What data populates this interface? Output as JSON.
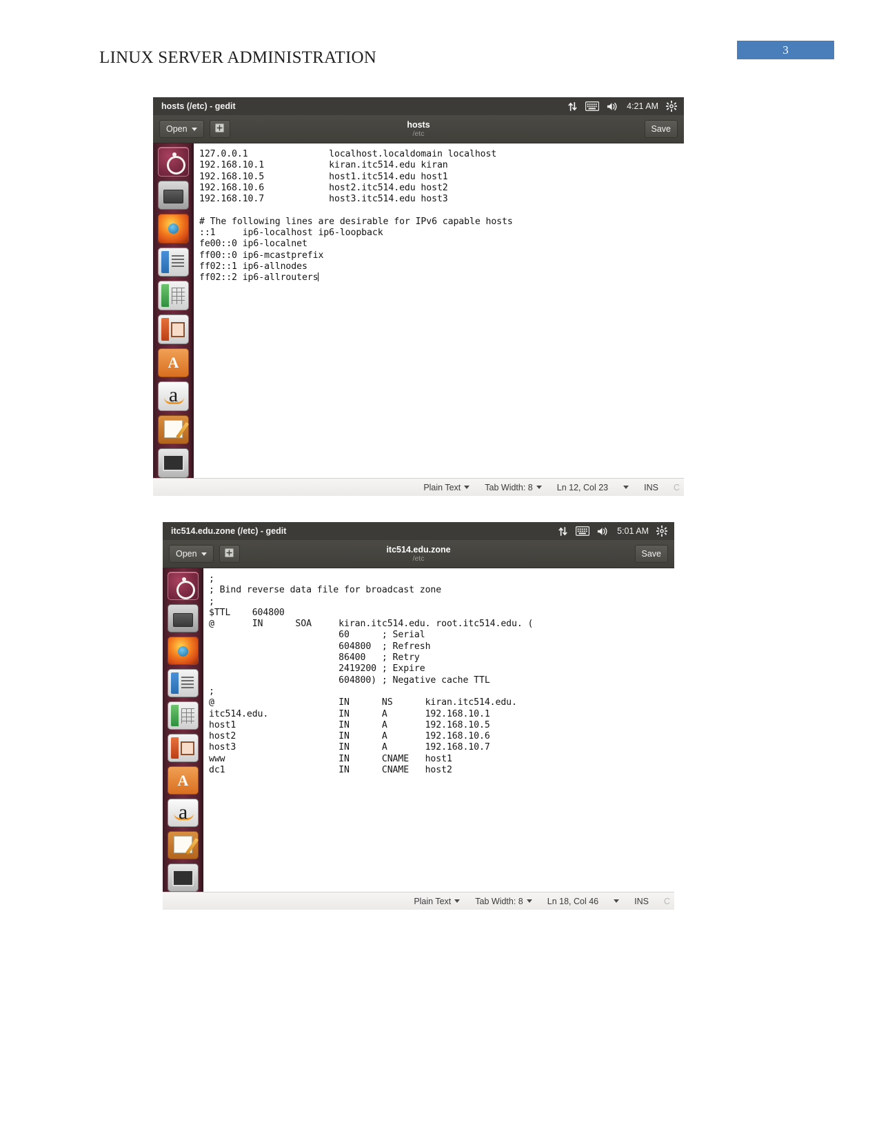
{
  "document": {
    "title": "LINUX SERVER ADMINISTRATION",
    "page_number": "3",
    "page_badge_color": "#4a7ebb"
  },
  "windows": [
    {
      "titlebar": {
        "title": "hosts (/etc) - gedit",
        "clock": "4:21 AM",
        "icons": [
          "network-updown-icon",
          "keyboard-icon",
          "volume-icon",
          "gear-icon"
        ]
      },
      "headerbar": {
        "open_label": "Open",
        "open_caret": "▾",
        "new_tab_icon": "new-document-icon",
        "filename": "hosts",
        "filepath": "/etc",
        "save_label": "Save"
      },
      "launcher": [
        "ubuntu-dash-icon",
        "files-icon",
        "firefox-icon",
        "libreoffice-writer-icon",
        "libreoffice-calc-icon",
        "libreoffice-impress-icon",
        "ubuntu-software-icon",
        "amazon-icon",
        "gedit-icon",
        "system-monitor-icon"
      ],
      "content": "127.0.0.1\t\tlocalhost.localdomain localhost\n192.168.10.1\t\tkiran.itc514.edu kiran\n192.168.10.5\t\thost1.itc514.edu host1\n192.168.10.6\t\thost2.itc514.edu host2\n192.168.10.7\t\thost3.itc514.edu host3\n\n# The following lines are desirable for IPv6 capable hosts\n::1     ip6-localhost ip6-loopback\nfe00::0 ip6-localnet\nff00::0 ip6-mcastprefix\nff02::1 ip6-allnodes\nff02::2 ip6-allrouters",
      "statusbar": {
        "language": "Plain Text",
        "tab_width": "Tab Width: 8",
        "position": "Ln 12, Col 23",
        "insert_mode": "INS",
        "cut_label": "C"
      }
    },
    {
      "titlebar": {
        "title": "itc514.edu.zone (/etc) - gedit",
        "clock": "5:01 AM",
        "icons": [
          "network-updown-icon",
          "keyboard-icon",
          "volume-icon",
          "gear-icon"
        ]
      },
      "headerbar": {
        "open_label": "Open",
        "open_caret": "▾",
        "new_tab_icon": "new-document-icon",
        "filename": "itc514.edu.zone",
        "filepath": "/etc",
        "save_label": "Save"
      },
      "launcher": [
        "ubuntu-dash-icon",
        "files-icon",
        "firefox-icon",
        "libreoffice-writer-icon",
        "libreoffice-calc-icon",
        "libreoffice-impress-icon",
        "ubuntu-software-icon",
        "amazon-icon",
        "gedit-icon",
        "system-monitor-icon"
      ],
      "content": ";\n; Bind reverse data file for broadcast zone\n;\n$TTL    604800\n@       IN      SOA     kiran.itc514.edu. root.itc514.edu. (\n                        60      ; Serial\n                        604800  ; Refresh\n                        86400   ; Retry\n                        2419200 ; Expire\n                        604800) ; Negative cache TTL\n;\n@                       IN      NS      kiran.itc514.edu.\nitc514.edu.             IN      A       192.168.10.1\nhost1                   IN      A       192.168.10.5\nhost2                   IN      A       192.168.10.6\nhost3                   IN      A       192.168.10.7\nwww                     IN      CNAME   host1\ndc1                     IN      CNAME   host2",
      "statusbar": {
        "language": "Plain Text",
        "tab_width": "Tab Width: 8",
        "position": "Ln 18, Col 46",
        "insert_mode": "INS",
        "cut_label": "C"
      }
    }
  ]
}
